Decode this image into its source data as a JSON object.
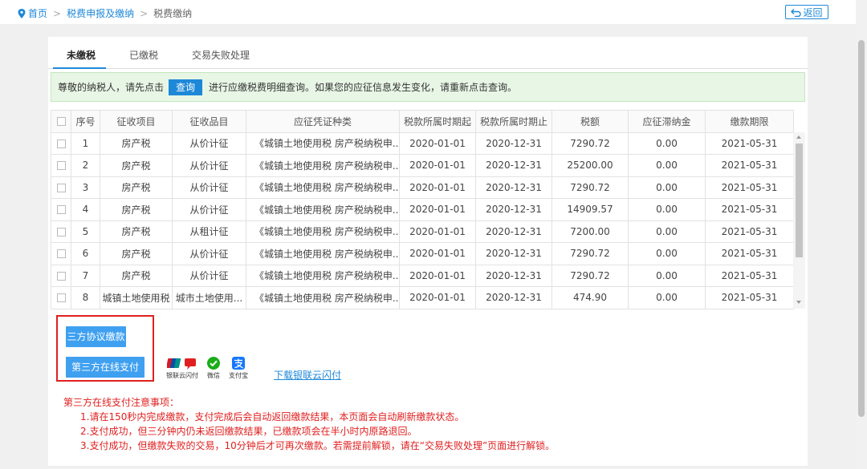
{
  "breadcrumb": {
    "home": "首页",
    "level2": "税费申报及缴纳",
    "level3": "税费缴纳"
  },
  "back_label": "返回",
  "tabs": [
    "未缴税",
    "已缴税",
    "交易失败处理"
  ],
  "notice": {
    "before": "尊敬的纳税人，请先点击",
    "query_button": "查询",
    "after": "进行应缴税费明细查询。如果您的应征信息发生变化，请重新点击查询。"
  },
  "table": {
    "columns": [
      "序号",
      "征收项目",
      "征收品目",
      "应征凭证种类",
      "税款所属时期起",
      "税款所属时期止",
      "税额",
      "应征滞纳金",
      "缴款期限"
    ],
    "rows": [
      [
        "1",
        "房产税",
        "从价计征",
        "《城镇土地使用税 房产税纳税申...",
        "2020-01-01",
        "2020-12-31",
        "7290.72",
        "0.00",
        "2021-05-31"
      ],
      [
        "2",
        "房产税",
        "从价计征",
        "《城镇土地使用税 房产税纳税申...",
        "2020-01-01",
        "2020-12-31",
        "25200.00",
        "0.00",
        "2021-05-31"
      ],
      [
        "3",
        "房产税",
        "从价计征",
        "《城镇土地使用税 房产税纳税申...",
        "2020-01-01",
        "2020-12-31",
        "7290.72",
        "0.00",
        "2021-05-31"
      ],
      [
        "4",
        "房产税",
        "从价计征",
        "《城镇土地使用税 房产税纳税申...",
        "2020-01-01",
        "2020-12-31",
        "14909.57",
        "0.00",
        "2021-05-31"
      ],
      [
        "5",
        "房产税",
        "从租计征",
        "《城镇土地使用税 房产税纳税申...",
        "2020-01-01",
        "2020-12-31",
        "7200.00",
        "0.00",
        "2021-05-31"
      ],
      [
        "6",
        "房产税",
        "从价计征",
        "《城镇土地使用税 房产税纳税申...",
        "2020-01-01",
        "2020-12-31",
        "7290.72",
        "0.00",
        "2021-05-31"
      ],
      [
        "7",
        "房产税",
        "从价计征",
        "《城镇土地使用税 房产税纳税申...",
        "2020-01-01",
        "2020-12-31",
        "7290.72",
        "0.00",
        "2021-05-31"
      ],
      [
        "8",
        "城镇土地使用税",
        "城市土地使用...",
        "《城镇土地使用税 房产税纳税申...",
        "2020-01-01",
        "2020-12-31",
        "474.90",
        "0.00",
        "2021-05-31"
      ]
    ]
  },
  "buttons": {
    "tripartite": "三方协议缴款",
    "online": "第三方在线支付"
  },
  "pay_methods": [
    {
      "icon": "unionpay-quickpass-icon",
      "label": "银联云闪付"
    },
    {
      "icon": "wechat-pay-icon",
      "label": "微信"
    },
    {
      "icon": "alipay-icon",
      "label": "支付宝"
    }
  ],
  "download_link": "下载银联云闪付",
  "notes": {
    "title": "第三方在线支付注意事项：",
    "items": [
      "1.请在150秒内完成缴款，支付完成后会自动返回缴款结果，本页面会自动刷新缴款状态。",
      "2.支付成功，但三分钟内仍未返回缴款结果，已缴款项会在半小时内原路退回。",
      "3.支付成功，但缴款失败的交易，10分钟后才可再次缴款。若需提前解锁，请在“交易失败处理”页面进行解锁。"
    ]
  },
  "colors": {
    "link": "#1e88d8",
    "button": "#3fa0f0",
    "warning": "#e02020",
    "notice_bg": "#e8f6e6"
  }
}
